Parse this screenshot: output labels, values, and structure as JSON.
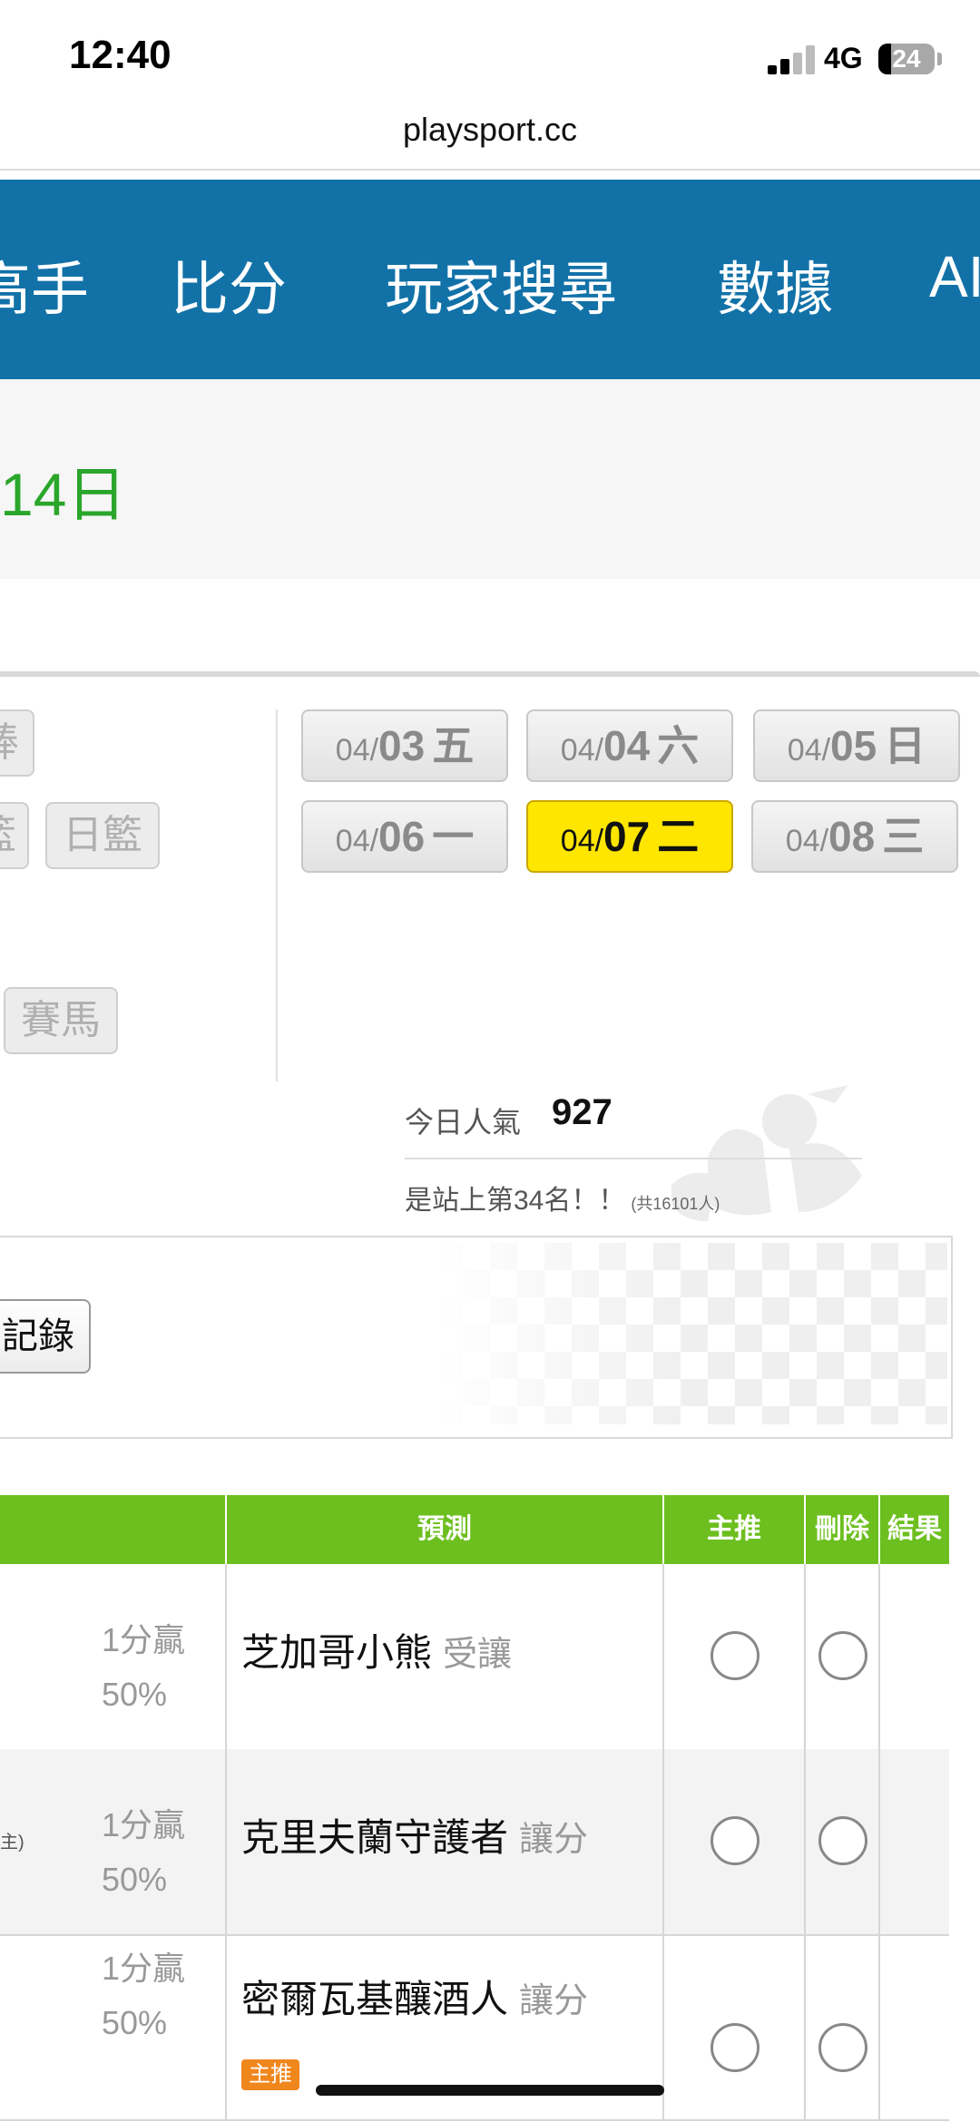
{
  "status_bar": {
    "time": "12:40",
    "network": "4G",
    "battery": "24"
  },
  "url": "playsport.cc",
  "nav": {
    "items": [
      "高手",
      "比分",
      "玩家搜尋",
      "數據",
      "AI"
    ]
  },
  "banner": {
    "date_fragment": "14日"
  },
  "sports": [
    "棒",
    "籃",
    "日籃",
    "賽馬"
  ],
  "dates": [
    {
      "month": "04/",
      "day": "03",
      "weekday": "五"
    },
    {
      "month": "04/",
      "day": "04",
      "weekday": "六"
    },
    {
      "month": "04/",
      "day": "05",
      "weekday": "日"
    },
    {
      "month": "04/",
      "day": "06",
      "weekday": "一"
    },
    {
      "month": "04/",
      "day": "07",
      "weekday": "二",
      "active": true
    },
    {
      "month": "04/",
      "day": "08",
      "weekday": "三"
    }
  ],
  "popularity": {
    "label": "今日人氣",
    "value": "927",
    "rank_text": "是站上第34名！！",
    "rank_total": "(共16101人)"
  },
  "record_button": "記錄",
  "table": {
    "headers": {
      "prediction": "預測",
      "main_pick": "主推",
      "delete": "刪除",
      "result": "結果"
    },
    "rows": [
      {
        "score": "1分贏",
        "pct": "50%",
        "team": "芝加哥小熊",
        "handicap": "受讓",
        "side_note": "",
        "main_tag": ""
      },
      {
        "score": "1分贏",
        "pct": "50%",
        "team": "克里夫蘭守護者",
        "handicap": "讓分",
        "side_note": "主)",
        "main_tag": ""
      },
      {
        "score": "1分贏",
        "pct": "50%",
        "team": "密爾瓦基釀酒人",
        "handicap": "讓分",
        "side_note": "",
        "main_tag": "主推"
      }
    ]
  },
  "colors": {
    "nav_bg": "#1272a8",
    "table_header": "#6cbf1e",
    "active_date": "#ffe600",
    "date_green": "#2aa62a"
  }
}
